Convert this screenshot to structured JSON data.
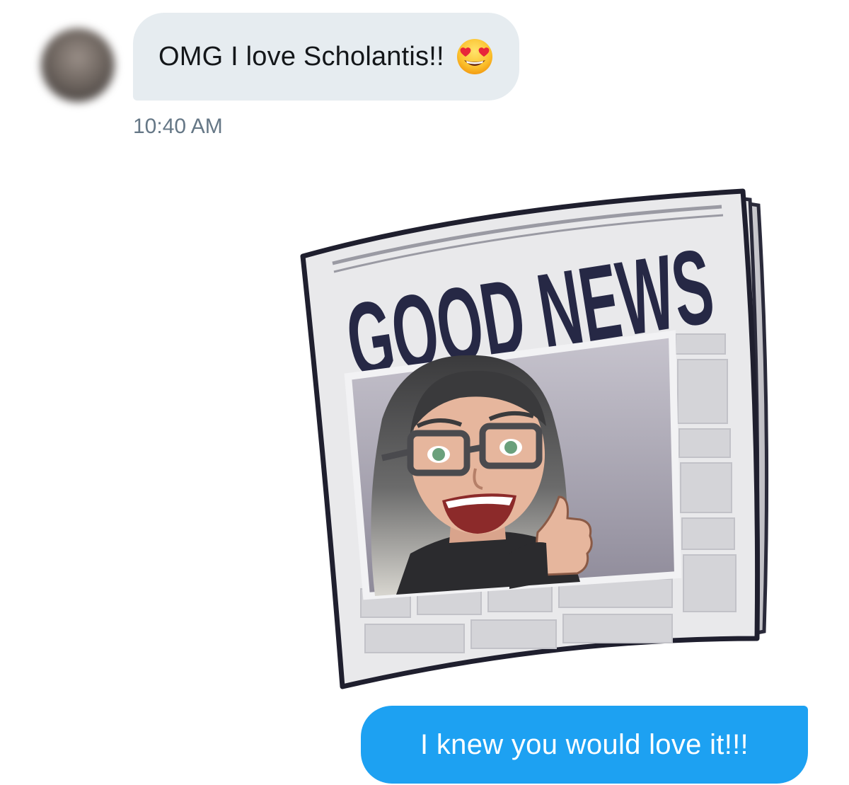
{
  "conversation": {
    "incoming": {
      "text": "OMG I love Scholantis!!",
      "emoji": "smiling-face-with-heart-eyes",
      "timestamp": "10:40 AM",
      "bubble_color": "#e6ecf0",
      "text_color": "#14171a"
    },
    "sticker": {
      "headline": "GOOD NEWS",
      "icon": "newspaper-sticker"
    },
    "outgoing": {
      "text": "I knew you would love it!!!",
      "bubble_color": "#1da1f2",
      "text_color": "#ffffff"
    },
    "timestamp_color": "#657786"
  }
}
